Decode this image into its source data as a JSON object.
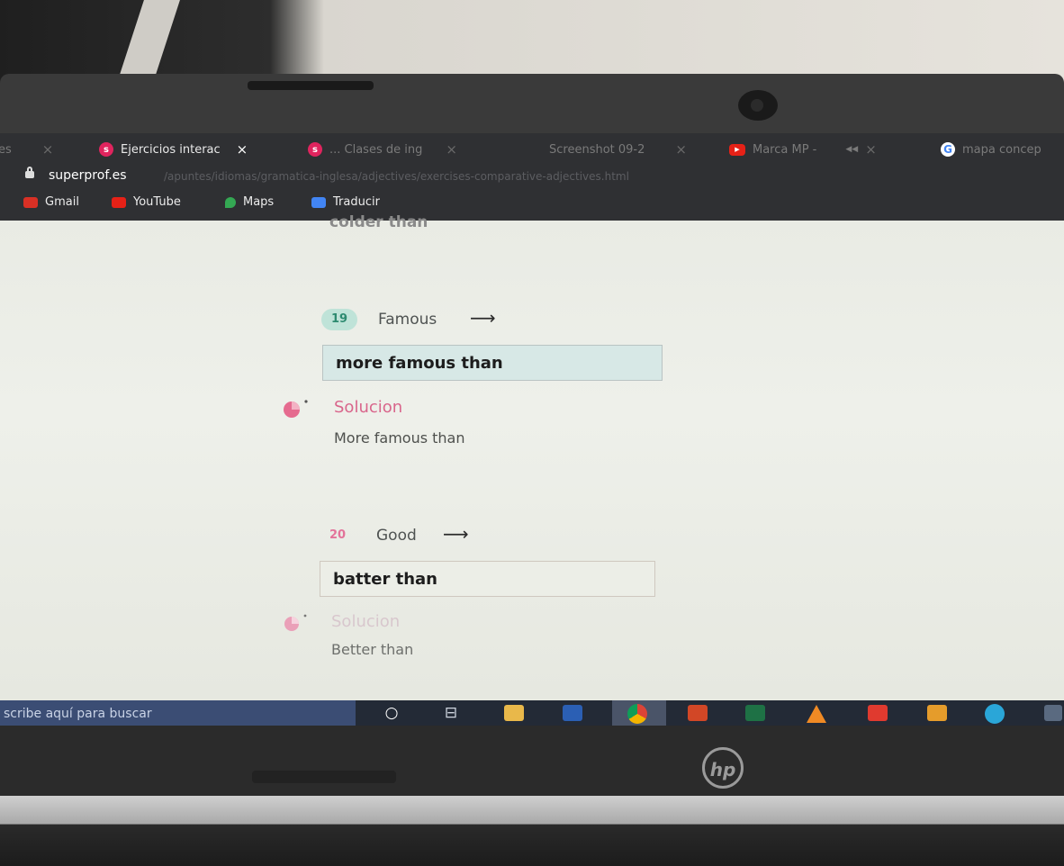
{
  "browser": {
    "tabs": [
      {
        "label": "es",
        "fav_color": "",
        "fav_char": "",
        "dim": true
      },
      {
        "label": "Ejercicios interac",
        "fav_color": "#e0245e",
        "fav_char": "s",
        "dim": false
      },
      {
        "label": "... Clases de ing",
        "fav_color": "#e0245e",
        "fav_char": "s",
        "dim": true
      },
      {
        "label": "Screenshot 09-2",
        "fav_color": "",
        "fav_char": "",
        "dim": true
      },
      {
        "label": "Marca MP -",
        "fav_color": "#e62117",
        "fav_char": "▶",
        "dim": true
      },
      {
        "label": "mapa concep",
        "fav_color": "#ffffff",
        "fav_char": "G",
        "dim": true
      }
    ],
    "close_glyph": "×",
    "mute_glyph": "◀◀",
    "url_host": "superprof.es",
    "url_path": "/apuntes/idiomas/gramatica-inglesa/adjectives/exercises-comparative-adjectives.html",
    "bookmarks": [
      {
        "label": "Gmail",
        "color": "#d93025"
      },
      {
        "label": "YouTube",
        "color": "#e62117"
      },
      {
        "label": "Maps",
        "color": "#34a853"
      },
      {
        "label": "Traducir",
        "color": "#4285f4"
      }
    ]
  },
  "page": {
    "cut_text": "colder than",
    "questions": [
      {
        "number": "19",
        "word": "Famous",
        "arrow": "⟶",
        "answer": "more famous than",
        "solution_label": "Solucion",
        "solution": "More famous than"
      },
      {
        "number": "20",
        "word": "Good",
        "arrow": "⟶",
        "answer": "batter than",
        "solution_label": "Solucion",
        "solution": "Better than"
      }
    ]
  },
  "taskbar": {
    "search_placeholder": "scribe aquí para buscar",
    "cortana_glyph": "○",
    "taskview_glyph": "⊟"
  },
  "device": {
    "brand": "hp"
  }
}
